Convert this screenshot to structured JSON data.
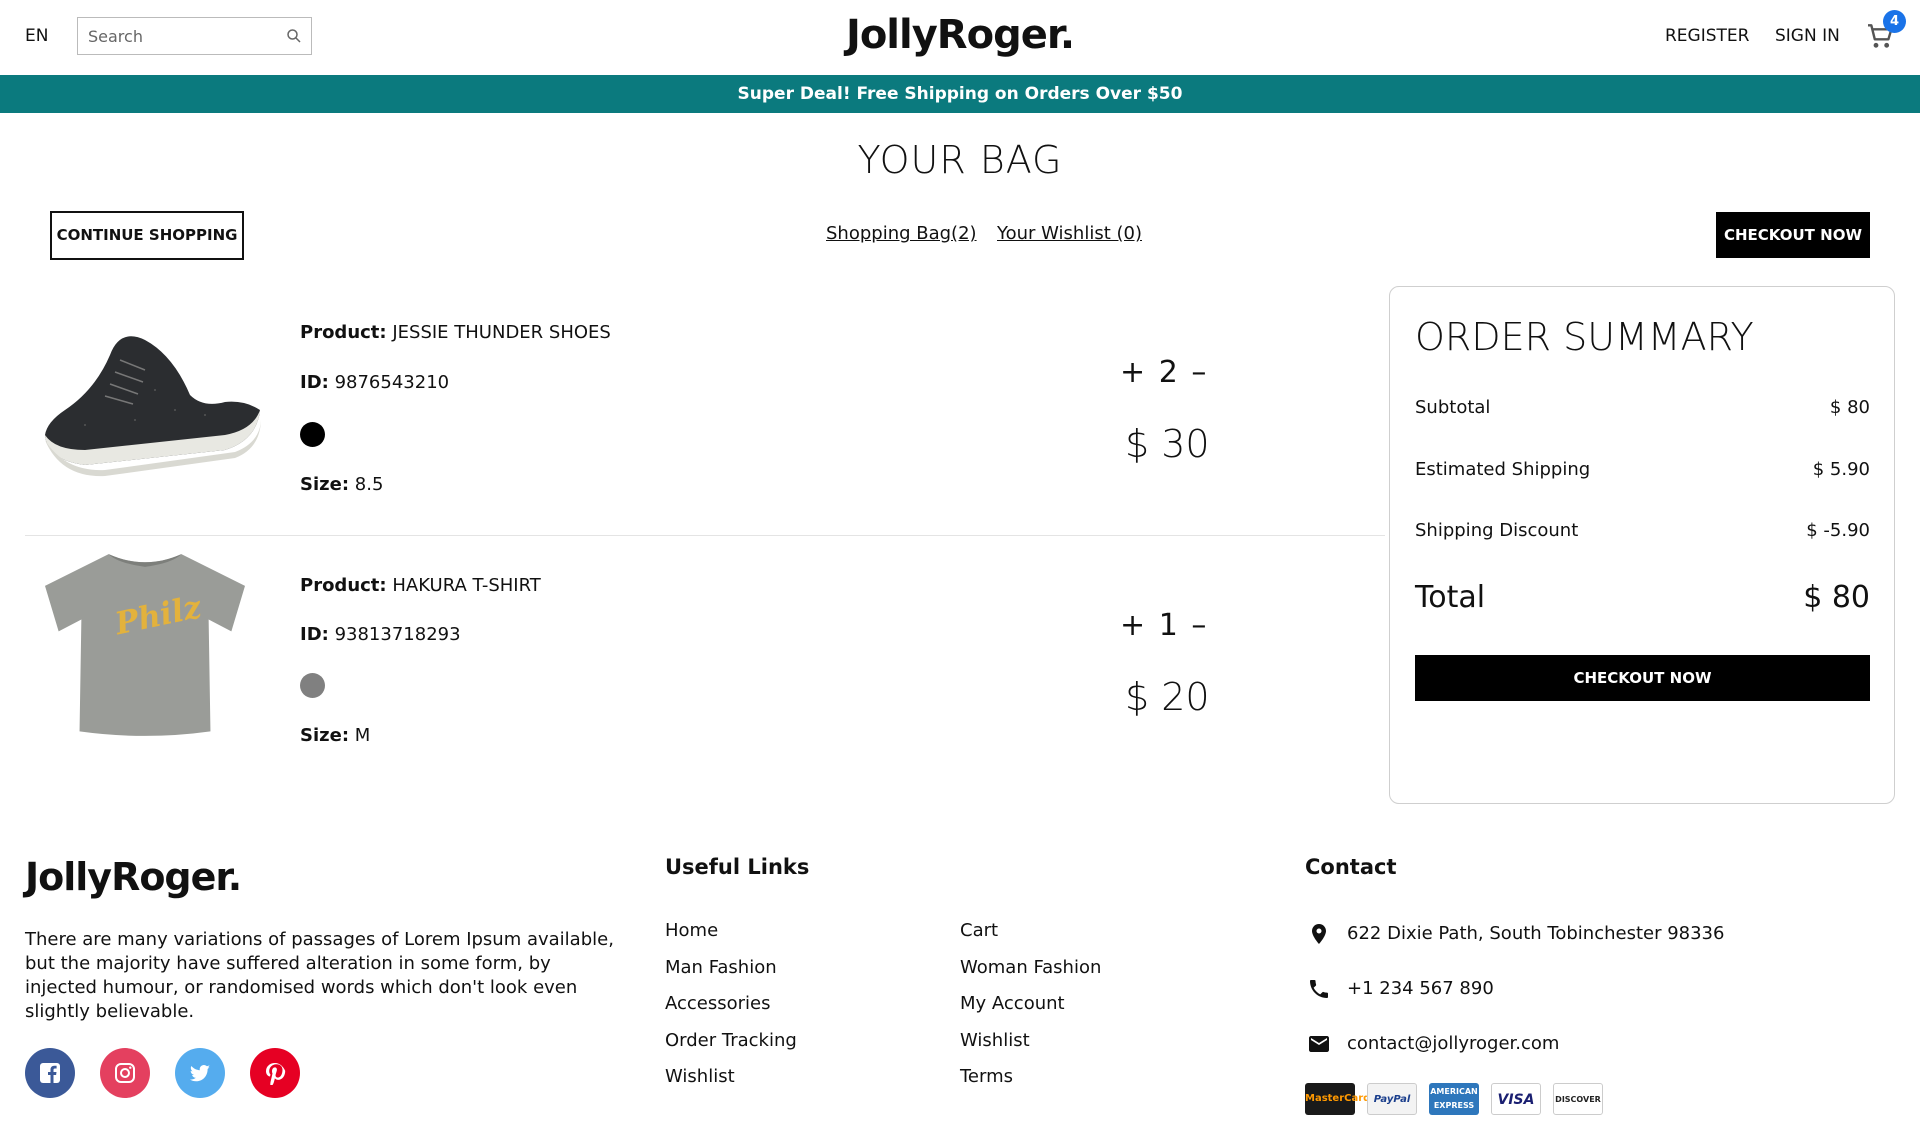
{
  "header": {
    "language": "EN",
    "search_placeholder": "Search",
    "logo": "JollyRoger.",
    "register": "REGISTER",
    "sign_in": "SIGN IN",
    "cart_count": "4"
  },
  "banner": {
    "text": "Super Deal! Free Shipping on Orders Over $50"
  },
  "page": {
    "title": "YOUR BAG",
    "continue_shopping": "CONTINUE SHOPPING",
    "shopping_bag_tab": "Shopping Bag(2)",
    "wishlist_tab": "Your Wishlist (0)",
    "checkout_now": "CHECKOUT NOW"
  },
  "products": [
    {
      "product_label": "Product:",
      "product_name": "JESSIE THUNDER SHOES",
      "id_label": "ID:",
      "id": "9876543210",
      "color": "#000000",
      "size_label": "Size:",
      "size": "8.5",
      "plus": "+",
      "quantity": "2",
      "minus": "–",
      "price": "$ 30"
    },
    {
      "product_label": "Product:",
      "product_name": "HAKURA T-SHIRT",
      "id_label": "ID:",
      "id": "93813718293",
      "color": "#808080",
      "size_label": "Size:",
      "size": "M",
      "plus": "+",
      "quantity": "1",
      "minus": "–",
      "price": "$ 20",
      "shirt_print": "Philz"
    }
  ],
  "summary": {
    "title": "ORDER SUMMARY",
    "subtotal_label": "Subtotal",
    "subtotal_value": "$ 80",
    "shipping_label": "Estimated Shipping",
    "shipping_value": "$ 5.90",
    "discount_label": "Shipping Discount",
    "discount_value": "$ -5.90",
    "total_label": "Total",
    "total_value": "$ 80",
    "checkout": "CHECKOUT NOW"
  },
  "footer": {
    "logo": "JollyRoger.",
    "description": "There are many variations of passages of Lorem Ipsum available, but the majority have suffered alteration in some form, by injected humour, or randomised words which don't look even slightly believable.",
    "useful_links_title": "Useful Links",
    "links_col1": [
      "Home",
      "Man Fashion",
      "Accessories",
      "Order Tracking",
      "Wishlist"
    ],
    "links_col2": [
      "Cart",
      "Woman Fashion",
      "My Account",
      "Wishlist",
      "Terms"
    ],
    "contact_title": "Contact",
    "address": "622 Dixie Path, South Tobinchester 98336",
    "phone": "+1 234 567 890",
    "email": "contact@jollyroger.com",
    "payments": [
      "MasterCard",
      "PayPal",
      "AMERICAN EXPRESS",
      "VISA",
      "DISCOVER"
    ]
  },
  "colors": {
    "banner": "#0b7a7e",
    "cart_badge": "#1a73e8",
    "facebook": "#3b5998",
    "instagram": "#e4405f",
    "twitter": "#55acee",
    "pinterest": "#e60023"
  },
  "icons": [
    "search-icon",
    "cart-icon",
    "facebook-icon",
    "instagram-icon",
    "twitter-icon",
    "pinterest-icon",
    "location-icon",
    "phone-icon",
    "mail-icon"
  ]
}
